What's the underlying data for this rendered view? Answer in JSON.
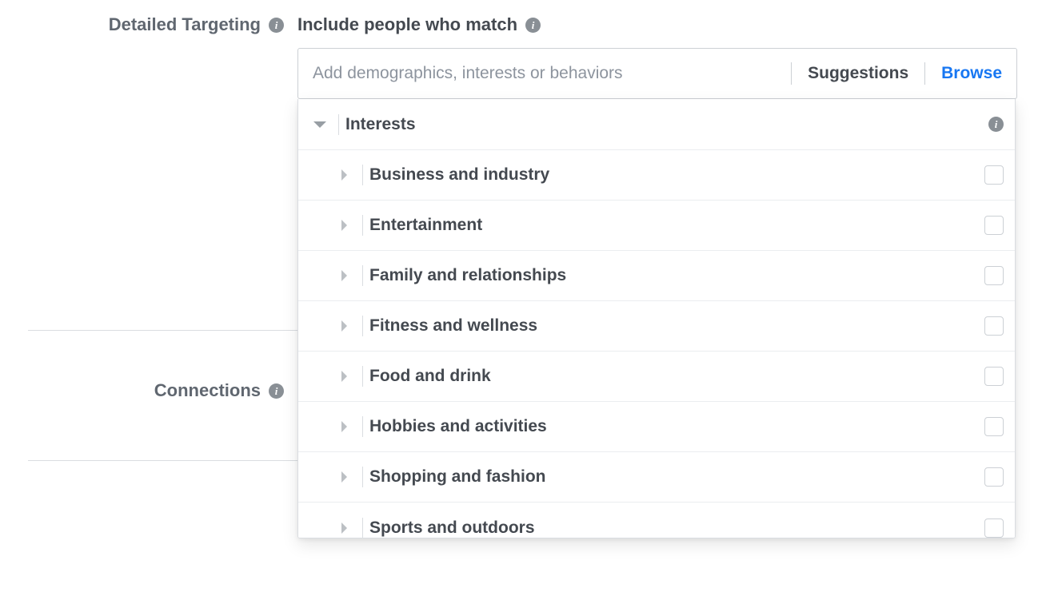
{
  "sections": {
    "detailed_targeting": "Detailed Targeting",
    "connections": "Connections"
  },
  "field": {
    "include_label": "Include people who match",
    "placeholder": "Add demographics, interests or behaviors",
    "suggestions": "Suggestions",
    "browse": "Browse"
  },
  "panel": {
    "header": "Interests",
    "categories": [
      "Business and industry",
      "Entertainment",
      "Family and relationships",
      "Fitness and wellness",
      "Food and drink",
      "Hobbies and activities",
      "Shopping and fashion",
      "Sports and outdoors"
    ]
  },
  "glyphs": {
    "info": "i"
  }
}
